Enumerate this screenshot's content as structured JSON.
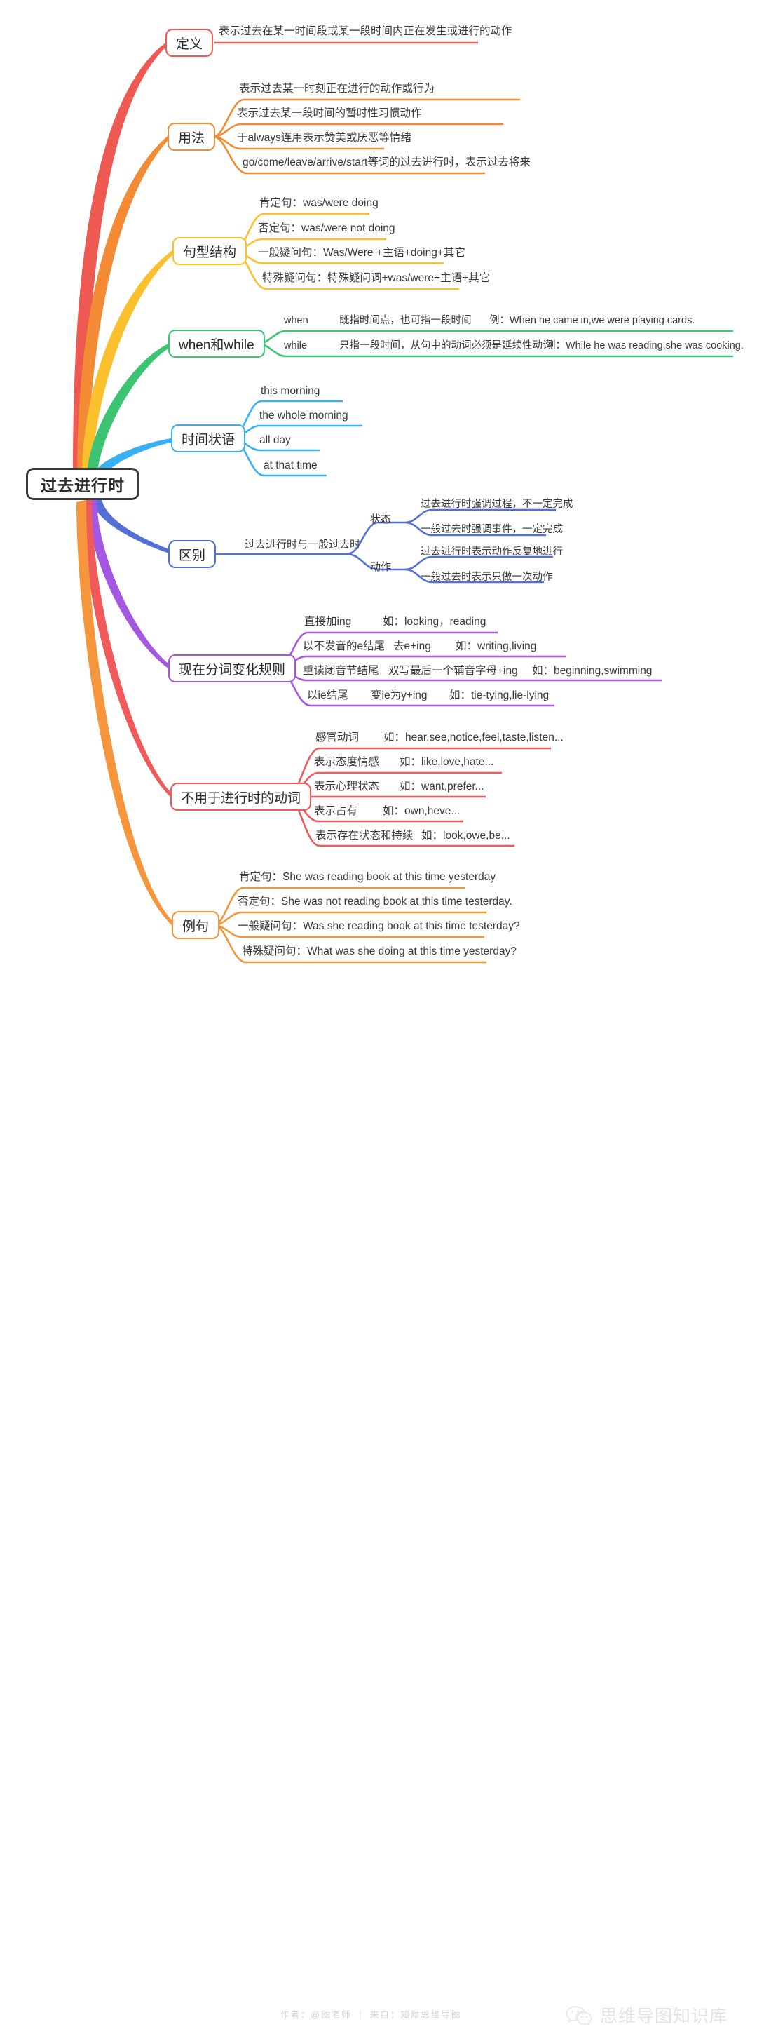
{
  "root": {
    "label": "过去进行时",
    "color": "#3c3c3c"
  },
  "branches": [
    {
      "label": "定义",
      "color": "#ee5a52",
      "children": [
        {
          "label": "表示过去在某一时间段或某一段时间内正在发生或进行的动作"
        }
      ]
    },
    {
      "label": "用法",
      "color": "#f38b35",
      "children": [
        {
          "label": "表示过去某一时刻正在进行的动作或行为"
        },
        {
          "label": "表示过去某一段时间的暂时性习惯动作"
        },
        {
          "label": "于always连用表示赞美或厌恶等情绪"
        },
        {
          "label": "go/come/leave/arrive/start等词的过去进行时，表示过去将来"
        }
      ]
    },
    {
      "label": "句型结构",
      "color": "#fbc02d",
      "children": [
        {
          "label": "肯定句：was/were doing"
        },
        {
          "label": "否定句：was/were not doing"
        },
        {
          "label": "一般疑问句：Was/Were +主语+doing+其它"
        },
        {
          "label": "特殊疑问句：特殊疑问词+was/were+主语+其它"
        }
      ]
    },
    {
      "label": "when和while",
      "color": "#3cc473",
      "children": [
        {
          "label": "when",
          "detail": "既指时间点，也可指一段时间",
          "example": "例：When he came in,we were playing cards."
        },
        {
          "label": "while",
          "detail": "只指一段时间，从句中的动词必须是延续性动词",
          "example": "例：While he was reading,she was cooking."
        }
      ]
    },
    {
      "label": "时间状语",
      "color": "#38b0f4",
      "children": [
        {
          "label": "this morning"
        },
        {
          "label": "the whole morning"
        },
        {
          "label": "all day"
        },
        {
          "label": "at that time"
        }
      ]
    },
    {
      "label": "区别",
      "color": "#5470d6",
      "mid_label": "过去进行时与一般过去时",
      "groups": [
        {
          "label": "状态",
          "children": [
            {
              "label": "过去进行时强调过程，不一定完成"
            },
            {
              "label": "一般过去时强调事件，一定完成"
            }
          ]
        },
        {
          "label": "动作",
          "children": [
            {
              "label": "过去进行时表示动作反复地进行"
            },
            {
              "label": "一般过去时表示只做一次动作"
            }
          ]
        }
      ]
    },
    {
      "label": "现在分词变化规则",
      "color": "#a457e0",
      "children": [
        {
          "label": "直接加ing",
          "rule": "",
          "example": "如：looking，reading"
        },
        {
          "label": "以不发音的e结尾",
          "rule": "去e+ing",
          "example": "如：writing,living"
        },
        {
          "label": "重读闭音节结尾",
          "rule": "双写最后一个辅音字母+ing",
          "example": "如：beginning,swimming"
        },
        {
          "label": "以ie结尾",
          "rule": "变ie为y+ing",
          "example": "如：tie-tying,lie-lying"
        }
      ]
    },
    {
      "label": "不用于进行时的动词",
      "color": "#f05a5a",
      "children": [
        {
          "label": "感官动词",
          "example": "如：hear,see,notice,feel,taste,listen..."
        },
        {
          "label": "表示态度情感",
          "example": "如：like,love,hate..."
        },
        {
          "label": "表示心理状态",
          "example": "如：want,prefer..."
        },
        {
          "label": "表示占有",
          "example": "如：own,heve..."
        },
        {
          "label": "表示存在状态和持续",
          "example": "如：look,owe,be..."
        }
      ]
    },
    {
      "label": "例句",
      "color": "#f5963c",
      "children": [
        {
          "label": "肯定句：She was reading book at this time yesterday"
        },
        {
          "label": "否定句：She was not reading book at this time testerday."
        },
        {
          "label": "一般疑问句：Was she reading book at this time testerday?"
        },
        {
          "label": "特殊疑问句：What was she doing at this time yesterday?"
        }
      ]
    }
  ],
  "footer": {
    "author_label": "作者：@图老师",
    "separator": "|",
    "source_label": "来自：知犀思维导图",
    "brand_text": "思维导图知识库",
    "brand_icon": "wechat-icon"
  }
}
